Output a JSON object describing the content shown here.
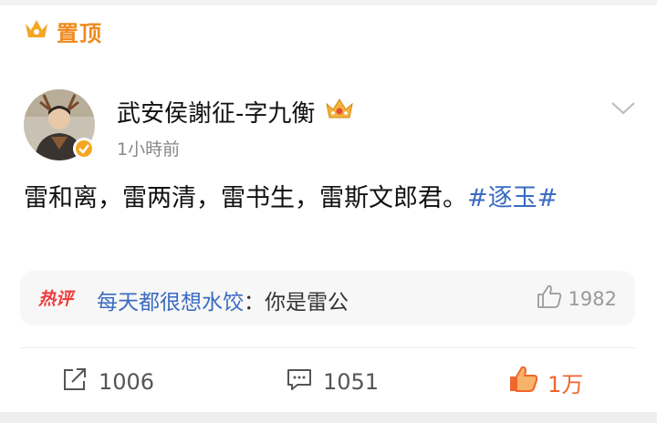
{
  "pinned": {
    "icon": "crown-icon",
    "label": "置顶",
    "color": "#f08a1d"
  },
  "post": {
    "author": "武安侯謝征-字九衡",
    "verified_badge": "crown-icon",
    "timestamp": "1小時前",
    "text": "雷和离，雷两清，雷书生，雷斯文郎君。",
    "hashtag": "#逐玉#"
  },
  "hot_comment": {
    "badge": "热评",
    "author": "每天都很想水饺",
    "separator": "：",
    "text": "你是雷公",
    "likes": "1982"
  },
  "actions": {
    "share_count": "1006",
    "comment_count": "1051",
    "like_count": "1万"
  },
  "colors": {
    "link": "#3b6bc2",
    "like_active": "#f0662d",
    "hot_badge": "#ef3b3b"
  }
}
